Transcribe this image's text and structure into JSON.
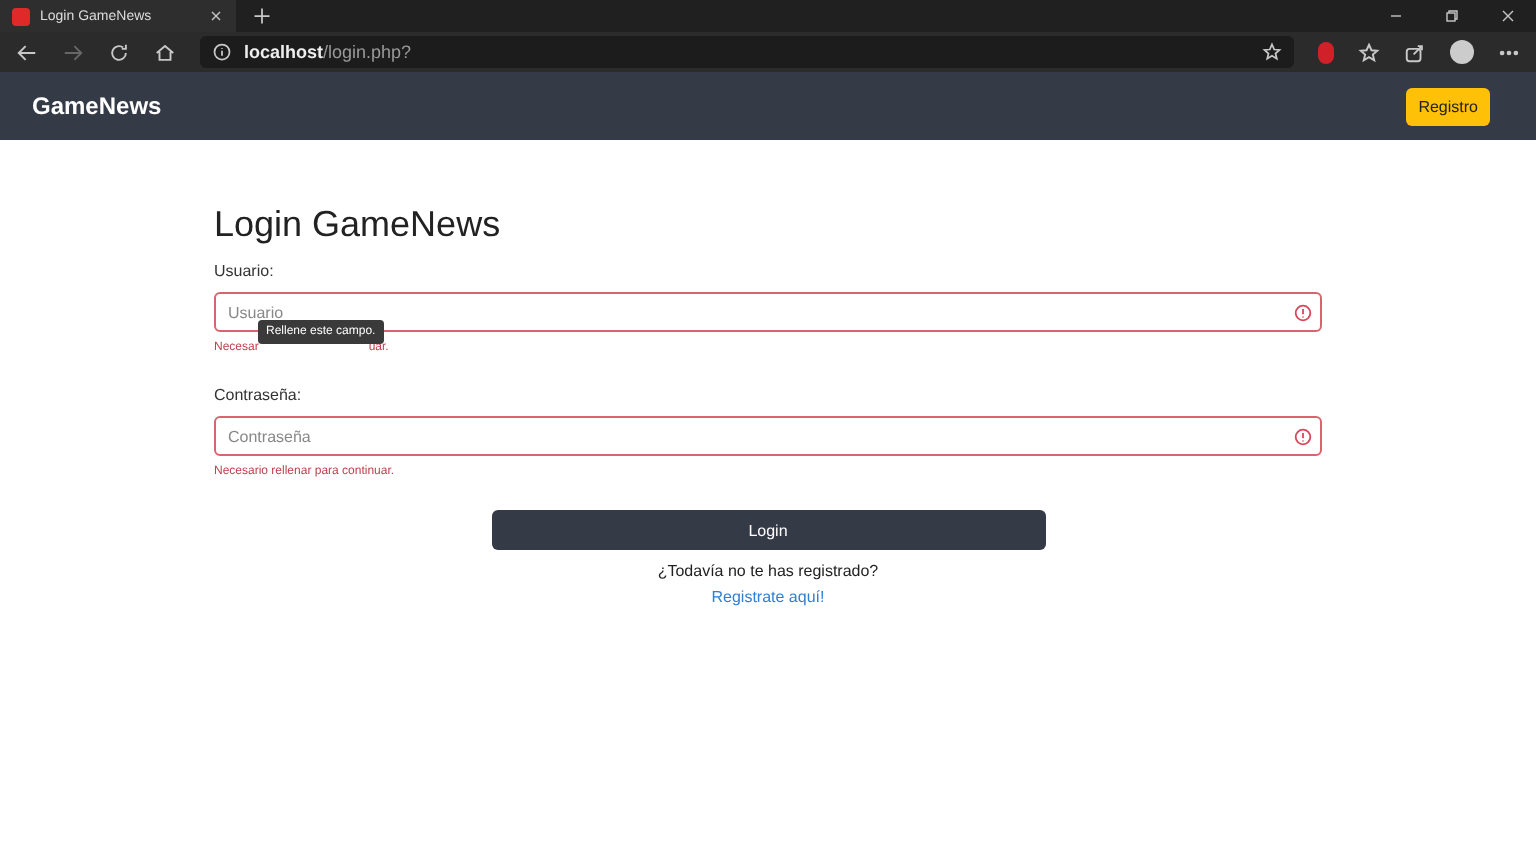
{
  "browser": {
    "tab": {
      "title": "Login GameNews",
      "selected": true
    },
    "url": {
      "host": "localhost",
      "path": "/login.php?"
    },
    "forward_disabled": true
  },
  "navbar": {
    "brand": "GameNews",
    "button": "Registro"
  },
  "form": {
    "title": "Login GameNews",
    "fields": [
      {
        "label": "Usuario:",
        "placeholder": "Usuario",
        "invalid": true,
        "error_parts": [
          "Necesar",
          "uar."
        ],
        "tooltip": "Rellene este campo."
      },
      {
        "label": "Contraseña:",
        "placeholder": "Contraseña",
        "invalid": true,
        "error_parts": [
          "Necesario rellenar para continuar."
        ]
      }
    ],
    "submit": "Login",
    "prompt": "¿Todavía no te has registrado?",
    "link": "Registrate aquí!"
  }
}
